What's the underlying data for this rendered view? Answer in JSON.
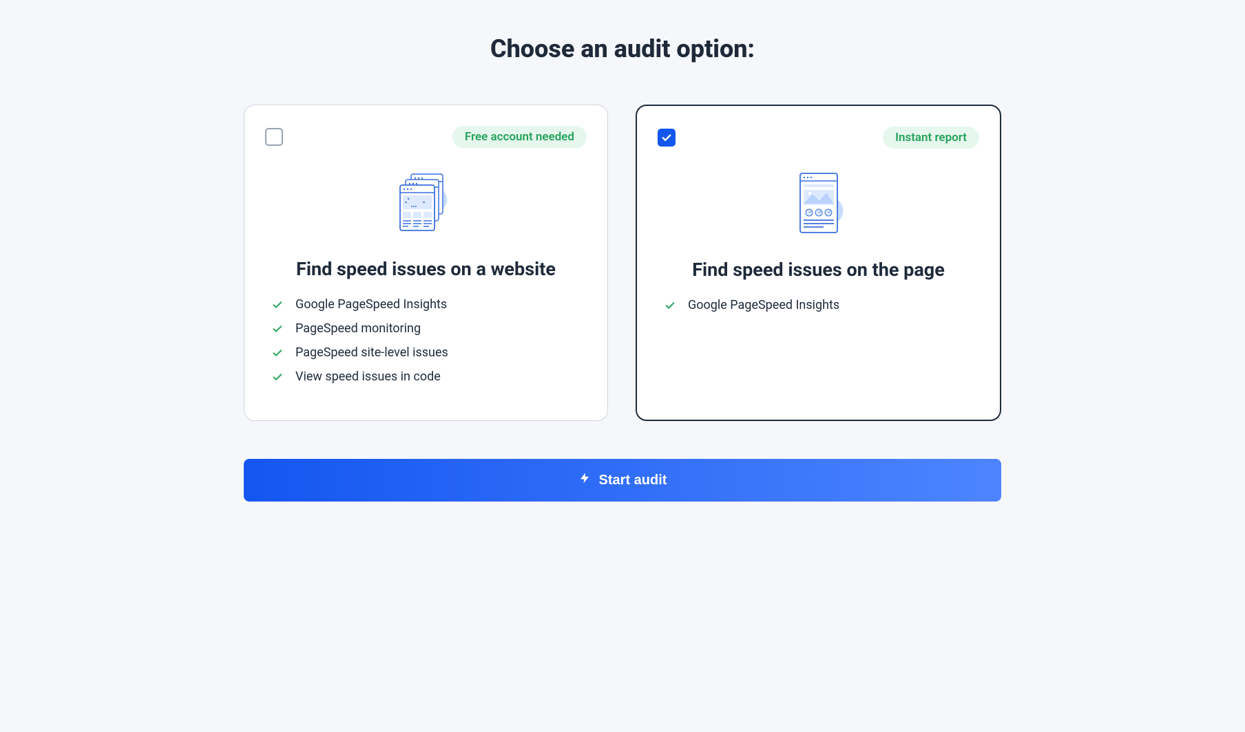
{
  "title": "Choose an audit option:",
  "options": [
    {
      "selected": false,
      "badge": "Free account needed",
      "heading": "Find speed issues on a website",
      "features": [
        "Google PageSpeed Insights",
        "PageSpeed monitoring",
        "PageSpeed site-level issues",
        "View speed issues in code"
      ]
    },
    {
      "selected": true,
      "badge": "Instant report",
      "heading": "Find speed issues on the page",
      "features": [
        "Google PageSpeed Insights"
      ]
    }
  ],
  "cta": "Start audit"
}
